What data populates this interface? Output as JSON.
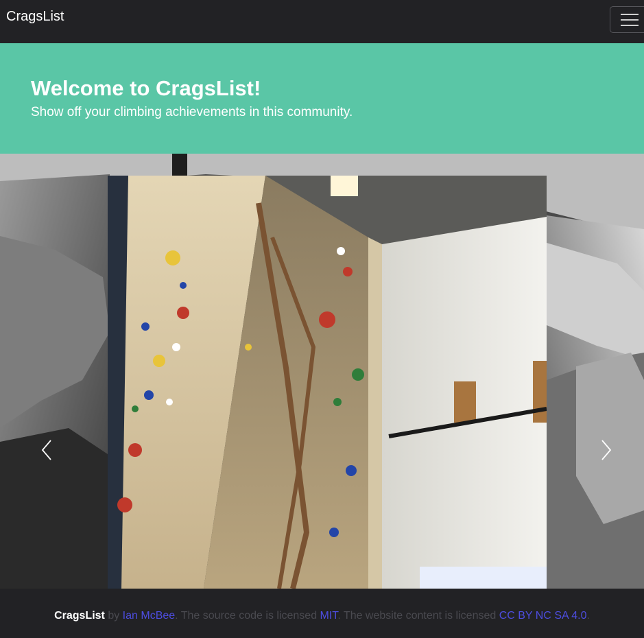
{
  "navbar": {
    "brand": "CragsList",
    "toggle_icon": "hamburger-icon"
  },
  "jumbotron": {
    "title": "Welcome to CragsList!",
    "subtitle": "Show off your climbing achievements in this community."
  },
  "carousel": {
    "prev_icon": "chevron-left-icon",
    "next_icon": "chevron-right-icon"
  },
  "footer": {
    "brand": "CragsList",
    "by_text": " by ",
    "author_link": "Ian McBee",
    "source_text": ". The source code is licensed ",
    "source_license_link": "MIT",
    "content_text": ". The website content is licensed ",
    "content_license_link": "CC BY NC SA 4.0",
    "end_text": "."
  },
  "colors": {
    "navbar_bg": "#222225",
    "jumbotron_bg": "#5ac6a6",
    "link": "#4d4de0",
    "footer_muted": "#4a4a50"
  }
}
